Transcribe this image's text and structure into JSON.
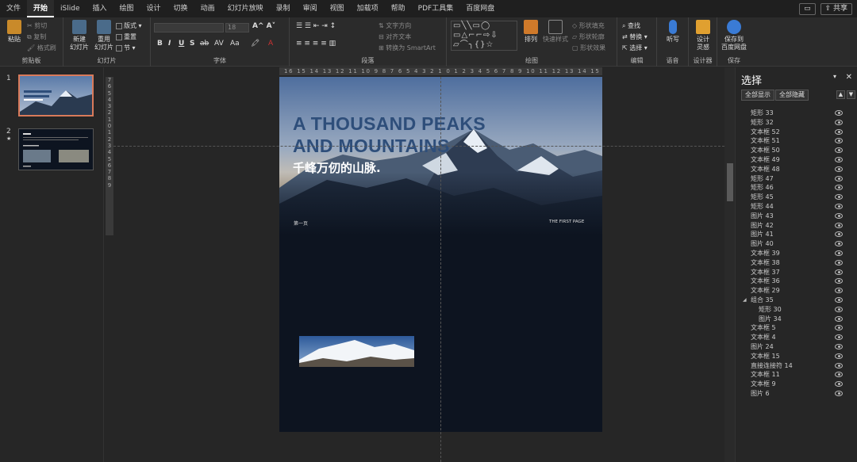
{
  "menubar": {
    "tabs": [
      "文件",
      "开始",
      "iSlide",
      "插入",
      "绘图",
      "设计",
      "切换",
      "动画",
      "幻灯片放映",
      "录制",
      "审阅",
      "视图",
      "加载项",
      "帮助",
      "PDF工具集",
      "百度网盘"
    ],
    "active_tab": "开始",
    "share": "共享"
  },
  "ribbon": {
    "groups": {
      "clipboard": "剪贴板",
      "slides": "幻灯片",
      "font": "字体",
      "paragraph": "段落",
      "drawing": "绘图",
      "editing": "编辑",
      "voice": "语音",
      "designer": "设计器",
      "save": "保存"
    },
    "paste": "粘贴",
    "cut": "剪切",
    "copy": "复制",
    "format_painter": "格式刷",
    "new_slide_1": "新建",
    "new_slide_2": "幻灯片",
    "reuse_1": "重用",
    "reuse_2": "幻灯片",
    "layout": "版式",
    "reset": "重置",
    "section": "节",
    "font_size": "18",
    "text_direction": "文字方向",
    "align_text": "对齐文本",
    "convert_smartart": "转换为 SmartArt",
    "arrange": "排列",
    "quick_styles": "快速样式",
    "shape_fill": "形状填充",
    "shape_outline": "形状轮廓",
    "shape_effects": "形状效果",
    "find": "查找",
    "replace": "替换",
    "select": "选择",
    "dictate": "听写",
    "design_ideas_1": "设计",
    "design_ideas_2": "灵感",
    "save_to_1": "保存到",
    "save_to_2": "百度网盘"
  },
  "thumbnails": [
    {
      "num": "1"
    },
    {
      "num": "2",
      "mark": "★"
    }
  ],
  "ruler": {
    "h": "16 15 14 13 12 11 10 9 8 7 6 5 4 3 2 1 0 1 2 3 4 5 6 7 8 9 10 11 12 13 14 15 16",
    "v": [
      "7",
      "6",
      "5",
      "4",
      "3",
      "2",
      "1",
      "0",
      "1",
      "2",
      "3",
      "4",
      "5",
      "6",
      "7",
      "8",
      "9"
    ]
  },
  "slide": {
    "title_line1": "A THOUSAND PEAKS",
    "title_line2": "AND MOUNTAINS",
    "subtitle": "千峰万仞的山脉.",
    "page_num": "第一页",
    "page_tag": "THE FIRST PAGE"
  },
  "selection_pane": {
    "title": "选择",
    "show_all": "全部显示",
    "hide_all": "全部隐藏",
    "items": [
      {
        "name": "矩形 33"
      },
      {
        "name": "矩形 32"
      },
      {
        "name": "文本框 52"
      },
      {
        "name": "文本框 51"
      },
      {
        "name": "文本框 50"
      },
      {
        "name": "文本框 49"
      },
      {
        "name": "文本框 48"
      },
      {
        "name": "矩形 47"
      },
      {
        "name": "矩形 46"
      },
      {
        "name": "矩形 45"
      },
      {
        "name": "矩形 44"
      },
      {
        "name": "图片 43"
      },
      {
        "name": "图片 42"
      },
      {
        "name": "图片 41"
      },
      {
        "name": "图片 40"
      },
      {
        "name": "文本框 39"
      },
      {
        "name": "文本框 38"
      },
      {
        "name": "文本框 37"
      },
      {
        "name": "文本框 36"
      },
      {
        "name": "文本框 29"
      },
      {
        "name": "组合 35",
        "group": true
      },
      {
        "name": "矩形 30",
        "child": true
      },
      {
        "name": "图片 34",
        "child": true
      },
      {
        "name": "文本框 5"
      },
      {
        "name": "文本框 4"
      },
      {
        "name": "图片 24"
      },
      {
        "name": "文本框 15"
      },
      {
        "name": "直接连接符 14"
      },
      {
        "name": "文本框 11"
      },
      {
        "name": "文本框 9"
      },
      {
        "name": "图片 6"
      }
    ]
  },
  "colors": {
    "accent": "#d97a5a",
    "title_blue": "#2e4e7a",
    "slide_bg": "#0d1420"
  }
}
